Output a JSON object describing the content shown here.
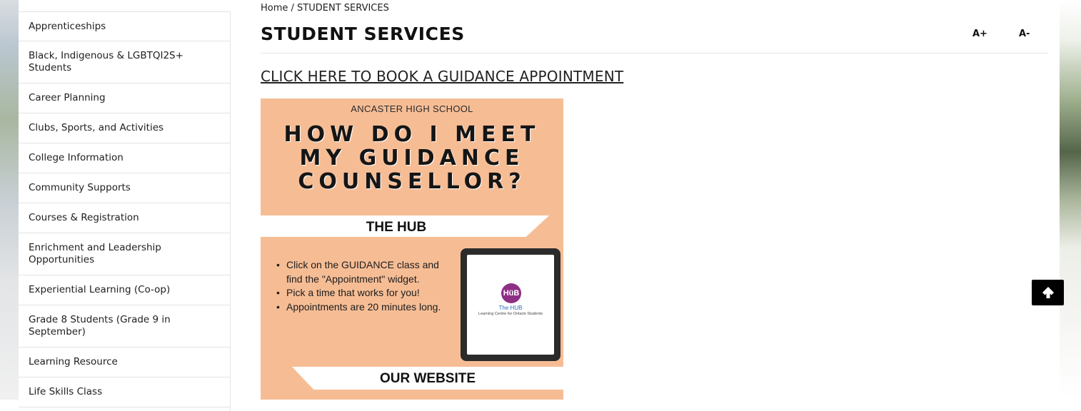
{
  "sidebar": {
    "items": [
      {
        "label": "Apprenticeships"
      },
      {
        "label": "Black, Indigenous & LGBTQI2S+ Students"
      },
      {
        "label": "Career Planning"
      },
      {
        "label": "Clubs, Sports, and Activities"
      },
      {
        "label": "College Information"
      },
      {
        "label": "Community Supports"
      },
      {
        "label": "Courses & Registration"
      },
      {
        "label": "Enrichment and Leadership Opportunities"
      },
      {
        "label": "Experiential Learning (Co-op)"
      },
      {
        "label": "Grade 8 Students (Grade 9 in September)"
      },
      {
        "label": "Learning Resource"
      },
      {
        "label": "Life Skills Class"
      }
    ]
  },
  "breadcrumb": {
    "home": "Home",
    "separator": " / ",
    "current": "STUDENT SERVICES"
  },
  "page": {
    "title": "STUDENT SERVICES",
    "font_increase": "A+",
    "font_decrease": "A-",
    "book_link": "CLICK HERE TO BOOK A GUIDANCE APPOINTMENT"
  },
  "poster": {
    "school": "ANCASTER HIGH SCHOOL",
    "headline_lines": [
      "HOW DO I MEET",
      "MY GUIDANCE",
      "COUNSELLOR?"
    ],
    "hub_heading": "THE HUB",
    "bullets": [
      "Click on the GUIDANCE class and find the \"Appointment\" widget.",
      "Pick a time that works for you!",
      "Appointments are 20 minutes long."
    ],
    "tablet_logo": "HüB",
    "tablet_name": "The HUB",
    "tablet_sub": "Learning Centre for Ontario Students",
    "website_heading": "OUR WEBSITE",
    "background_color": "#f6bd95"
  },
  "back_to_top": {
    "icon": "arrow-up-icon"
  }
}
